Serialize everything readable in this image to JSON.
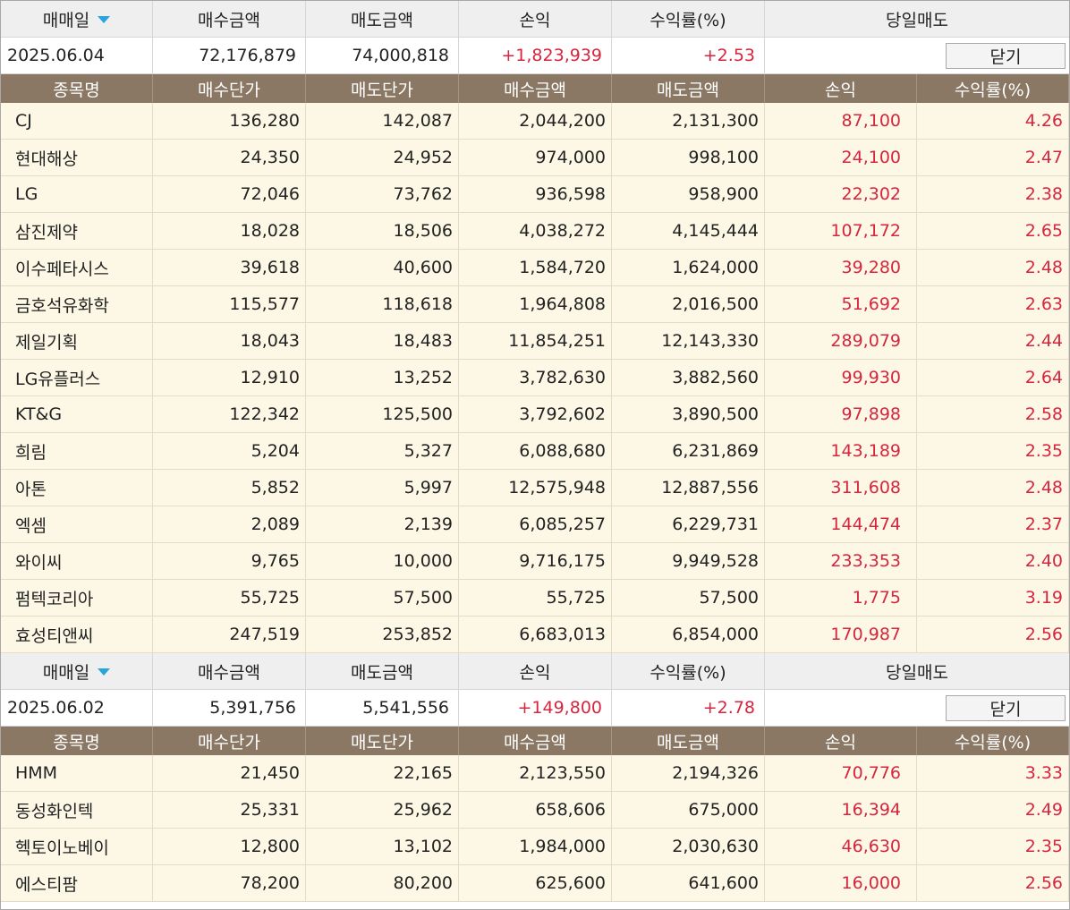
{
  "summary_headers": {
    "trade_date": "매매일",
    "buy_amount": "매수금액",
    "sell_amount": "매도금액",
    "profit": "손익",
    "return_rate": "수익률(%)",
    "same_day_sell": "당일매도"
  },
  "column_headers": {
    "name": "종목명",
    "buy_price": "매수단가",
    "sell_price": "매도단가",
    "buy_amount": "매수금액",
    "sell_amount": "매도금액",
    "profit": "손익",
    "return_rate": "수익률(%)"
  },
  "colors": {
    "positive": "#d6253e",
    "header_brown": "#8a7864",
    "row_cream": "#fdf8e6",
    "sort_arrow": "#2aa4dd"
  },
  "groups": [
    {
      "date": "2025.06.04",
      "buy_amount": "72,176,879",
      "sell_amount": "74,000,818",
      "profit": "+1,823,939",
      "return_rate": "+2.53",
      "close_label": "닫기",
      "rows": [
        {
          "name": "CJ",
          "buy_price": "136,280",
          "sell_price": "142,087",
          "buy_amount": "2,044,200",
          "sell_amount": "2,131,300",
          "profit": "87,100",
          "rate": "4.26"
        },
        {
          "name": "현대해상",
          "buy_price": "24,350",
          "sell_price": "24,952",
          "buy_amount": "974,000",
          "sell_amount": "998,100",
          "profit": "24,100",
          "rate": "2.47"
        },
        {
          "name": "LG",
          "buy_price": "72,046",
          "sell_price": "73,762",
          "buy_amount": "936,598",
          "sell_amount": "958,900",
          "profit": "22,302",
          "rate": "2.38"
        },
        {
          "name": "삼진제약",
          "buy_price": "18,028",
          "sell_price": "18,506",
          "buy_amount": "4,038,272",
          "sell_amount": "4,145,444",
          "profit": "107,172",
          "rate": "2.65"
        },
        {
          "name": "이수페타시스",
          "buy_price": "39,618",
          "sell_price": "40,600",
          "buy_amount": "1,584,720",
          "sell_amount": "1,624,000",
          "profit": "39,280",
          "rate": "2.48"
        },
        {
          "name": "금호석유화학",
          "buy_price": "115,577",
          "sell_price": "118,618",
          "buy_amount": "1,964,808",
          "sell_amount": "2,016,500",
          "profit": "51,692",
          "rate": "2.63"
        },
        {
          "name": "제일기획",
          "buy_price": "18,043",
          "sell_price": "18,483",
          "buy_amount": "11,854,251",
          "sell_amount": "12,143,330",
          "profit": "289,079",
          "rate": "2.44"
        },
        {
          "name": "LG유플러스",
          "buy_price": "12,910",
          "sell_price": "13,252",
          "buy_amount": "3,782,630",
          "sell_amount": "3,882,560",
          "profit": "99,930",
          "rate": "2.64"
        },
        {
          "name": "KT&G",
          "buy_price": "122,342",
          "sell_price": "125,500",
          "buy_amount": "3,792,602",
          "sell_amount": "3,890,500",
          "profit": "97,898",
          "rate": "2.58"
        },
        {
          "name": "희림",
          "buy_price": "5,204",
          "sell_price": "5,327",
          "buy_amount": "6,088,680",
          "sell_amount": "6,231,869",
          "profit": "143,189",
          "rate": "2.35"
        },
        {
          "name": "아톤",
          "buy_price": "5,852",
          "sell_price": "5,997",
          "buy_amount": "12,575,948",
          "sell_amount": "12,887,556",
          "profit": "311,608",
          "rate": "2.48"
        },
        {
          "name": "엑셈",
          "buy_price": "2,089",
          "sell_price": "2,139",
          "buy_amount": "6,085,257",
          "sell_amount": "6,229,731",
          "profit": "144,474",
          "rate": "2.37"
        },
        {
          "name": "와이씨",
          "buy_price": "9,765",
          "sell_price": "10,000",
          "buy_amount": "9,716,175",
          "sell_amount": "9,949,528",
          "profit": "233,353",
          "rate": "2.40"
        },
        {
          "name": "펌텍코리아",
          "buy_price": "55,725",
          "sell_price": "57,500",
          "buy_amount": "55,725",
          "sell_amount": "57,500",
          "profit": "1,775",
          "rate": "3.19"
        },
        {
          "name": "효성티앤씨",
          "buy_price": "247,519",
          "sell_price": "253,852",
          "buy_amount": "6,683,013",
          "sell_amount": "6,854,000",
          "profit": "170,987",
          "rate": "2.56"
        }
      ]
    },
    {
      "date": "2025.06.02",
      "buy_amount": "5,391,756",
      "sell_amount": "5,541,556",
      "profit": "+149,800",
      "return_rate": "+2.78",
      "close_label": "닫기",
      "rows": [
        {
          "name": "HMM",
          "buy_price": "21,450",
          "sell_price": "22,165",
          "buy_amount": "2,123,550",
          "sell_amount": "2,194,326",
          "profit": "70,776",
          "rate": "3.33"
        },
        {
          "name": "동성화인텍",
          "buy_price": "25,331",
          "sell_price": "25,962",
          "buy_amount": "658,606",
          "sell_amount": "675,000",
          "profit": "16,394",
          "rate": "2.49"
        },
        {
          "name": "헥토이노베이",
          "buy_price": "12,800",
          "sell_price": "13,102",
          "buy_amount": "1,984,000",
          "sell_amount": "2,030,630",
          "profit": "46,630",
          "rate": "2.35"
        },
        {
          "name": "에스티팜",
          "buy_price": "78,200",
          "sell_price": "80,200",
          "buy_amount": "625,600",
          "sell_amount": "641,600",
          "profit": "16,000",
          "rate": "2.56"
        }
      ]
    }
  ]
}
